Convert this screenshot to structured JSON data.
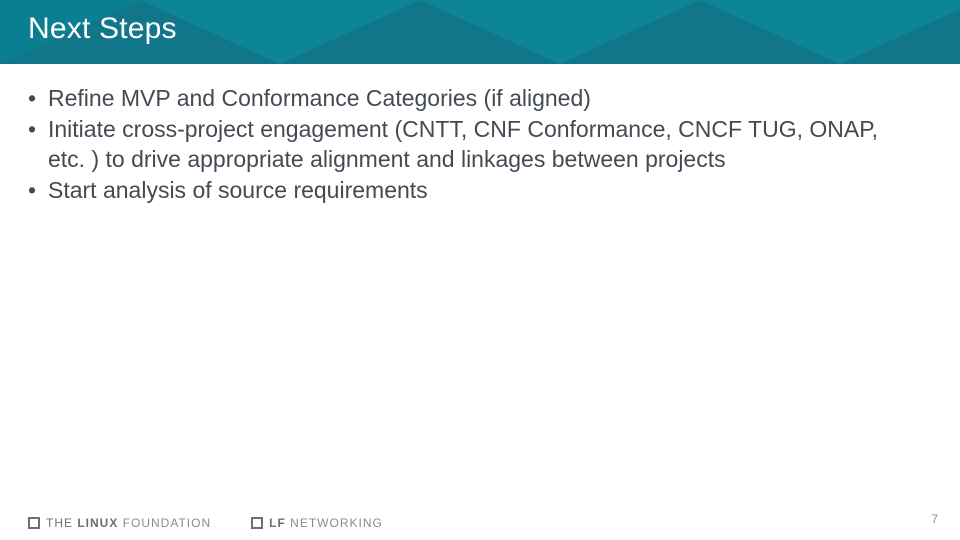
{
  "header": {
    "title": "Next Steps"
  },
  "bullets": [
    "Refine MVP and Conformance Categories (if aligned)",
    "Initiate cross-project engagement (CNTT, CNF Conformance, CNCF TUG, ONAP, etc. ) to drive appropriate alignment and linkages between projects",
    "Start analysis of source requirements"
  ],
  "footer": {
    "logo1_the": "THE",
    "logo1_bold": "LINUX",
    "logo1_light": "FOUNDATION",
    "logo2_bold": "LF",
    "logo2_light": "NETWORKING",
    "page_number": "7"
  }
}
